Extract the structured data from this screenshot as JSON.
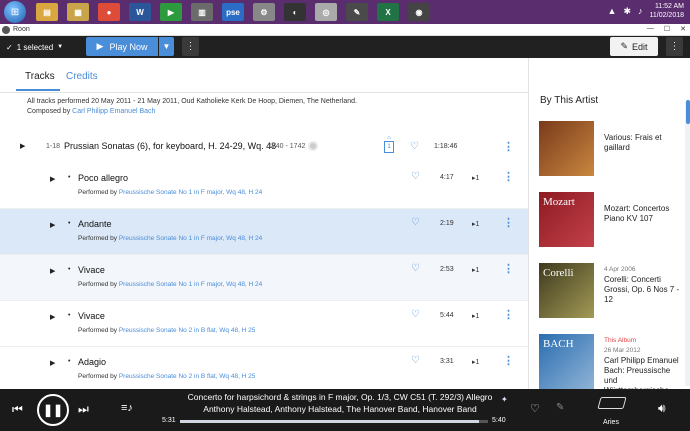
{
  "taskbar": {
    "apps": [
      {
        "name": "folder-app",
        "color": "#d9a640",
        "glyph": "▤"
      },
      {
        "name": "library-app",
        "color": "#c9a44a",
        "glyph": "▦"
      },
      {
        "name": "chrome-app",
        "color": "#dd4b39",
        "glyph": "●"
      },
      {
        "name": "word-app",
        "color": "#2b579a",
        "glyph": "W"
      },
      {
        "name": "media-app",
        "color": "#2e9a3e",
        "glyph": "▶"
      },
      {
        "name": "settings-app",
        "color": "#6b6b6b",
        "glyph": "▥"
      },
      {
        "name": "pse-app",
        "color": "#2b6cc4",
        "glyph": "pse"
      },
      {
        "name": "tools-app",
        "color": "#888",
        "glyph": "⚙"
      },
      {
        "name": "circle-app",
        "color": "#333",
        "glyph": "◐"
      },
      {
        "name": "disc-app",
        "color": "#aaa",
        "glyph": "◎"
      },
      {
        "name": "pen-app",
        "color": "#4a4a4a",
        "glyph": "✎"
      },
      {
        "name": "excel-app",
        "color": "#217346",
        "glyph": "X"
      },
      {
        "name": "roon-app",
        "color": "#444",
        "glyph": "◉"
      }
    ],
    "clock_time": "11:52 AM",
    "clock_date": "11/02/2018"
  },
  "window": {
    "app_name": "Roon"
  },
  "toolbar": {
    "selection": "1 selected",
    "play_now": "Play Now",
    "edit": "Edit"
  },
  "tabs": {
    "tracks": "Tracks",
    "credits": "Credits"
  },
  "info": {
    "recording": "All tracks performed 20 May 2011 - 21 May 2011, Oud Katholieke Kerk De Hoop, Diemen, The Netherland.",
    "composed_prefix": "Composed by",
    "composer": "Carl Philipp Emanuel Bach"
  },
  "work": {
    "range": "1-18",
    "title": "Prussian Sonatas (6), for keyboard, H. 24-29, Wq. 48",
    "years": "1740 - 1742",
    "disc": "1",
    "duration": "1:18:46"
  },
  "performed_by": "Performed by",
  "tracks": [
    {
      "name": "Poco allegro",
      "work": "Preussische Sonate No 1 in F major, Wq 48, H 24",
      "duration": "4:17",
      "plays": "1",
      "style": "normal"
    },
    {
      "name": "Andante",
      "work": "Preussische Sonate No 1 in F major, Wq 48, H 24",
      "duration": "2:19",
      "plays": "1",
      "style": "selected"
    },
    {
      "name": "Vivace",
      "work": "Preussische Sonate No 1 in F major, Wq 48, H 24",
      "duration": "2:53",
      "plays": "1",
      "style": "alt"
    },
    {
      "name": "Vivace",
      "work": "Preussische Sonate No 2 in B flat, Wq 48, H 25",
      "duration": "5:44",
      "plays": "1",
      "style": "normal"
    },
    {
      "name": "Adagio",
      "work": "Preussische Sonate No 2 in B flat, Wq 48, H 25",
      "duration": "3:31",
      "plays": "1",
      "style": "normal"
    }
  ],
  "side": {
    "title": "By This Artist",
    "albums": [
      {
        "date": "",
        "tag": "",
        "title": "Various: Frais et gaillard",
        "art": [
          "#7a3a1a",
          "#c9873f"
        ],
        "art_text": ""
      },
      {
        "date": "",
        "tag": "",
        "title": "Mozart: Concertos Piano KV 107",
        "art": [
          "#8e1b22",
          "#c3404a"
        ],
        "art_text": "Mozart"
      },
      {
        "date": "4 Apr 2006",
        "tag": "",
        "title": "Corelli: Concerti Grossi, Op. 6 Nos 7 - 12",
        "art": [
          "#3e3a1e",
          "#a39a55"
        ],
        "art_text": "Corelli"
      },
      {
        "date": "26 Mar 2012",
        "tag": "This Album",
        "title": "Carl Philipp Emanuel Bach: Preussische und Württembergische",
        "art": [
          "#2a6db0",
          "#8fb3d6"
        ],
        "art_text": "BACH"
      }
    ]
  },
  "player": {
    "title": "Concerto for harpsichord & strings in F major, Op. 1/3, CW C51 (T. 292/3) Allegro",
    "artists": "Anthony Halstead, Anthony Halstead, The Hanover Band, Hanover Band",
    "elapsed": "5:31",
    "total": "5:40",
    "progress": 0.97,
    "zone": "Aries"
  },
  "colors": {
    "accent": "#4a8dd8",
    "selected_row": "#dbe8f7",
    "player_bg": "#1a1a1a"
  }
}
